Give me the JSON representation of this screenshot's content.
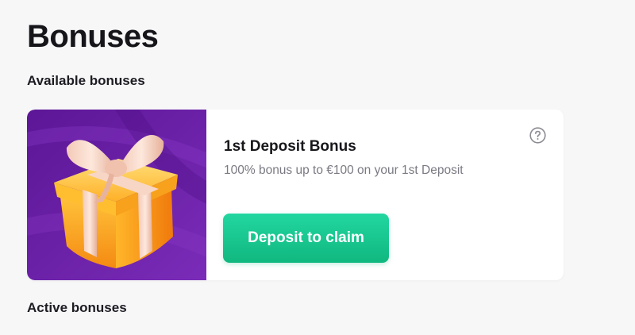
{
  "page": {
    "title": "Bonuses"
  },
  "sections": {
    "available_label": "Available bonuses",
    "active_label": "Active bonuses"
  },
  "bonus_card": {
    "image_icon": "gift-box-icon",
    "help_icon": "question-circle-icon",
    "title": "1st Deposit Bonus",
    "description": "100% bonus up to €100 on your 1st Deposit",
    "cta_label": "Deposit to claim"
  },
  "colors": {
    "accent": "#13c088",
    "image_background": "#6a1fa8"
  }
}
